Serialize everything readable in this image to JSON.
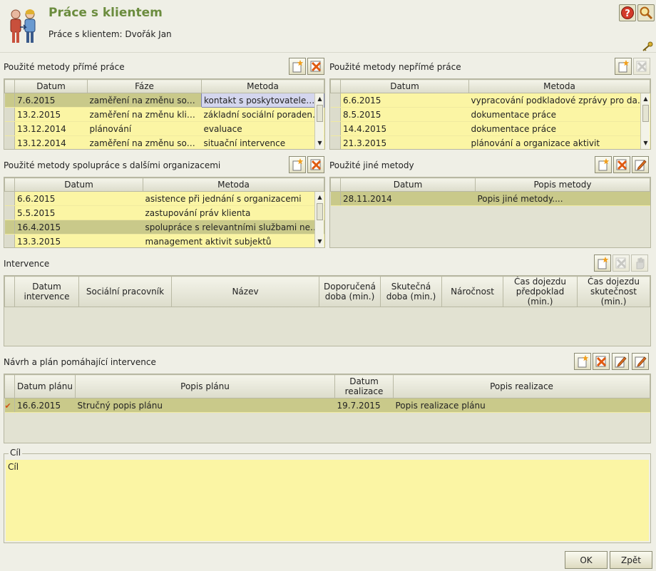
{
  "header": {
    "title": "Práce s klientem",
    "subtitle": "Práce s klientem: Dvořák Jan"
  },
  "direct_methods": {
    "label": "Použité metody přímé práce",
    "columns": [
      "Datum",
      "Fáze",
      "Metoda"
    ],
    "rows": [
      [
        "7.6.2015",
        "zaměření na změnu soc. pr...",
        "kontakt s poskytovatelem d..."
      ],
      [
        "13.2.2015",
        "zaměření na změnu klienta",
        "základní sociální poradens..."
      ],
      [
        "13.12.2014",
        "plánování",
        "evaluace"
      ],
      [
        "13.12.2014",
        "zaměření na změnu soc. pr...",
        "situační intervence"
      ]
    ]
  },
  "indirect_methods": {
    "label": "Použité metody nepřímé práce",
    "columns": [
      "Datum",
      "Metoda"
    ],
    "rows": [
      [
        "6.6.2015",
        "vypracování podkladové zprávy pro další i..."
      ],
      [
        "8.5.2015",
        "dokumentace práce"
      ],
      [
        "14.4.2015",
        "dokumentace práce"
      ],
      [
        "21.3.2015",
        "plánování a organizace aktivit"
      ]
    ]
  },
  "cooperation_methods": {
    "label": "Použité metody spolupráce s dalšími organizacemi",
    "columns": [
      "Datum",
      "Metoda"
    ],
    "rows": [
      [
        "6.6.2015",
        "asistence při jednání s organizacemi"
      ],
      [
        "5.5.2015",
        "zastupování práv klienta"
      ],
      [
        "16.4.2015",
        "spolupráce s relevantními službami nebo..."
      ],
      [
        "13.3.2015",
        "management aktivit subjektů"
      ]
    ]
  },
  "other_methods": {
    "label": "Použité jiné metody",
    "columns": [
      "Datum",
      "Popis metody"
    ],
    "rows": [
      [
        "28.11.2014",
        "Popis jiné metody...."
      ]
    ]
  },
  "interventions": {
    "label": "Intervence",
    "columns": [
      "Datum intervence",
      "Sociální pracovník",
      "Název",
      "Doporučená doba (min.)",
      "Skutečná doba (min.)",
      "Náročnost",
      "Čas dojezdu předpoklad (min.)",
      "Čas dojezdu skutečnost (min.)"
    ]
  },
  "plan": {
    "label": "Návrh a plán pomáhající intervence",
    "columns": [
      "Datum plánu",
      "Popis plánu",
      "Datum realizace",
      "Popis realizace"
    ],
    "rows": [
      [
        "16.6.2015",
        "Stručný popis plánu",
        "19.7.2015",
        "Popis realizace plánu"
      ]
    ]
  },
  "goal": {
    "legend": "Cíl",
    "value": "Cíl"
  },
  "buttons": {
    "ok": "OK",
    "back": "Zpět"
  },
  "colors": {
    "accent_green": "#6b8c3e",
    "row_yellow": "#fbf5a4",
    "row_selected": "#c9c98a",
    "cell_focus_blue": "#d4d6ee",
    "background": "#efefe6"
  }
}
